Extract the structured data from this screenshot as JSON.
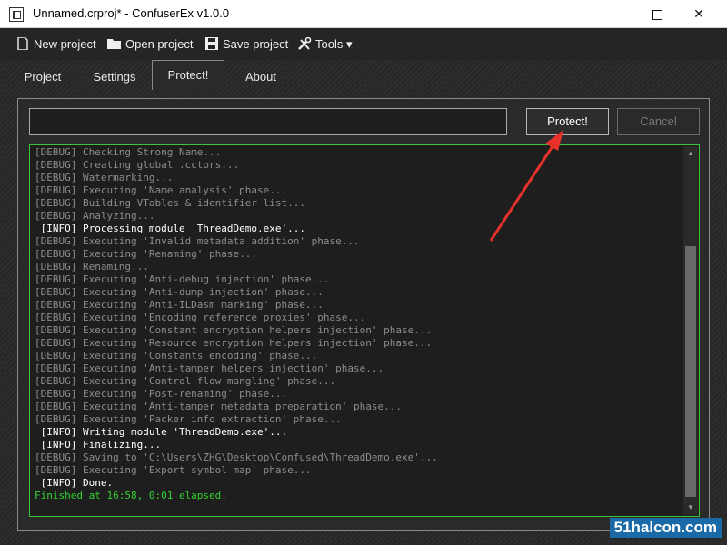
{
  "window": {
    "title": "Unnamed.crproj* - ConfuserEx v1.0.0",
    "minimize": "—",
    "close": "✕"
  },
  "toolbar": {
    "new_project": "New project",
    "open_project": "Open project",
    "save_project": "Save project",
    "tools": "Tools ▾"
  },
  "tabs": [
    {
      "label": "Project"
    },
    {
      "label": "Settings"
    },
    {
      "label": "Protect!"
    },
    {
      "label": "About"
    }
  ],
  "protect": {
    "input_value": "",
    "protect_button": "Protect!",
    "cancel_button": "Cancel"
  },
  "log": {
    "lines": [
      {
        "type": "debug",
        "text": "[DEBUG] Checking Strong Name..."
      },
      {
        "type": "debug",
        "text": "[DEBUG] Creating global .cctors..."
      },
      {
        "type": "debug",
        "text": "[DEBUG] Watermarking..."
      },
      {
        "type": "debug",
        "text": "[DEBUG] Executing 'Name analysis' phase..."
      },
      {
        "type": "debug",
        "text": "[DEBUG] Building VTables & identifier list..."
      },
      {
        "type": "debug",
        "text": "[DEBUG] Analyzing..."
      },
      {
        "type": "info",
        "text": " [INFO] Processing module 'ThreadDemo.exe'..."
      },
      {
        "type": "debug",
        "text": "[DEBUG] Executing 'Invalid metadata addition' phase..."
      },
      {
        "type": "debug",
        "text": "[DEBUG] Executing 'Renaming' phase..."
      },
      {
        "type": "debug",
        "text": "[DEBUG] Renaming..."
      },
      {
        "type": "debug",
        "text": "[DEBUG] Executing 'Anti-debug injection' phase..."
      },
      {
        "type": "debug",
        "text": "[DEBUG] Executing 'Anti-dump injection' phase..."
      },
      {
        "type": "debug",
        "text": "[DEBUG] Executing 'Anti-ILDasm marking' phase..."
      },
      {
        "type": "debug",
        "text": "[DEBUG] Executing 'Encoding reference proxies' phase..."
      },
      {
        "type": "debug",
        "text": "[DEBUG] Executing 'Constant encryption helpers injection' phase..."
      },
      {
        "type": "debug",
        "text": "[DEBUG] Executing 'Resource encryption helpers injection' phase..."
      },
      {
        "type": "debug",
        "text": "[DEBUG] Executing 'Constants encoding' phase..."
      },
      {
        "type": "debug",
        "text": "[DEBUG] Executing 'Anti-tamper helpers injection' phase..."
      },
      {
        "type": "debug",
        "text": "[DEBUG] Executing 'Control flow mangling' phase..."
      },
      {
        "type": "debug",
        "text": "[DEBUG] Executing 'Post-renaming' phase..."
      },
      {
        "type": "debug",
        "text": "[DEBUG] Executing 'Anti-tamper metadata preparation' phase..."
      },
      {
        "type": "debug",
        "text": "[DEBUG] Executing 'Packer info extraction' phase..."
      },
      {
        "type": "info",
        "text": " [INFO] Writing module 'ThreadDemo.exe'..."
      },
      {
        "type": "info",
        "text": " [INFO] Finalizing..."
      },
      {
        "type": "debug",
        "text": "[DEBUG] Saving to 'C:\\Users\\ZHG\\Desktop\\Confused\\ThreadDemo.exe'..."
      },
      {
        "type": "debug",
        "text": "[DEBUG] Executing 'Export symbol map' phase..."
      },
      {
        "type": "info",
        "text": " [INFO] Done."
      },
      {
        "type": "success",
        "text": "Finished at 16:58, 0:01 elapsed."
      }
    ]
  },
  "watermark": "51halcon.com",
  "colors": {
    "log_border": "#3cc43c",
    "success": "#32d232",
    "arrow": "#e8312b"
  }
}
